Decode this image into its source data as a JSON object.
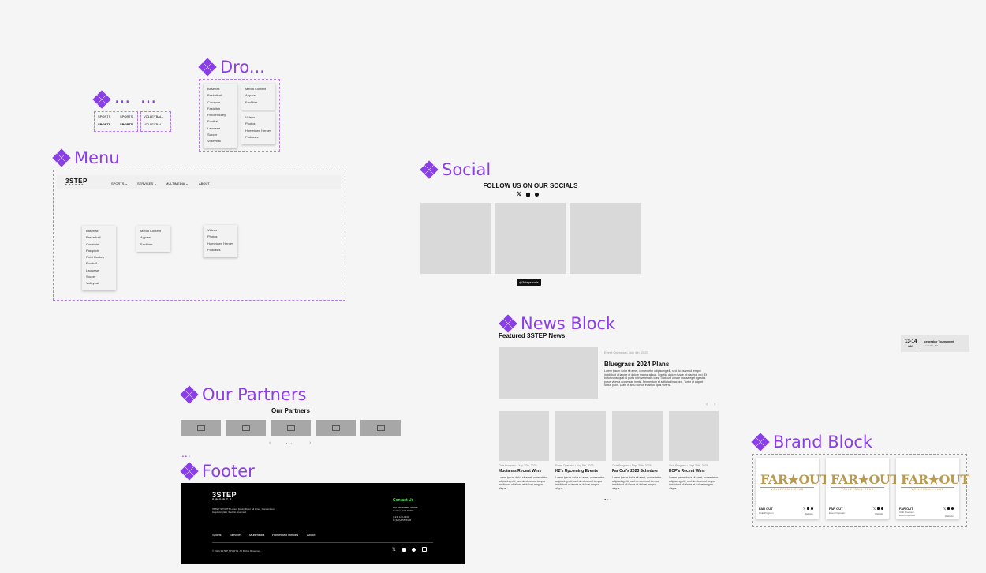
{
  "titles": {
    "dropdown": "Dro...",
    "small_a": "...",
    "small_b": "...",
    "menu": "Menu",
    "social": "Social",
    "news": "News Block",
    "partners": "Our Partners",
    "footer_dots": "...",
    "footer": "Footer",
    "brand": "Brand Block"
  },
  "variants": {
    "row1_a": "SPORTS",
    "row1_b": "SPORTS",
    "row2_a": "SPORTS",
    "row2_b": "SPORTS",
    "v1": "VOLLEYBALL",
    "v2": "VOLLEYBALL"
  },
  "dropdown": {
    "sports": [
      "Baseball",
      "Basketball",
      "Cornhole",
      "Fastpitch",
      "Field Hockey",
      "Football",
      "Lacrosse",
      "Soccer",
      "Volleyball"
    ],
    "services": [
      "Media Content",
      "Apparel",
      "Facilities"
    ],
    "multimedia": [
      "Videos",
      "Photos",
      "Hometown Heroes",
      "Podcasts"
    ]
  },
  "menu": {
    "logo": "3STEP",
    "logo_sub": "SPORTS",
    "nav": [
      "SPORTS",
      "SERVICES",
      "MULTIMEDIA",
      "ABOUT"
    ]
  },
  "social": {
    "heading": "FOLLOW US ON OUR SOCIALS",
    "handle": "@3stepsports",
    "icons": [
      "x-icon",
      "instagram-icon",
      "facebook-icon"
    ]
  },
  "news": {
    "heading": "Featured 3STEP News",
    "featured": {
      "meta": "Event Operator • July 4th, 2023",
      "title": "Bluegrass 2024 Plans",
      "body": "Lorem ipsum dolor sit amet, consectetur adipiscing elit, sed do eiusmod tempor incididunt ut labore et dolore magna aliqua. Gravida dictum fusce ut placerat orci. Et tortor consequat id porta nibh venenatis cras. Tincidunt ornare massa eget egestas purus viverra accumsan in nisl. Fermentum et sollicitudin ac orci. Tortor at aliquet luctus proin. Diam in arcu cursus euismod quis viverra."
    },
    "cards": [
      {
        "meta": "Club Program • July 27th, 2023",
        "title": "Mucianas Recent Wins",
        "body": "Lorem ipsum dolor sit amet, consectetur adipiscing elit, sed do eiusmod tempor incididunt ut labore et dolore magna aliqua."
      },
      {
        "meta": "Event Operator • Aug 8th, 2023",
        "title": "K2's Upcoming Events",
        "body": "Lorem ipsum dolor sit amet, consectetur adipiscing elit, sed do eiusmod tempor incididunt ut labore et dolore magna aliqua."
      },
      {
        "meta": "Club Program • Sept 30th, 2023",
        "title": "Far Out's 2023 Schedule",
        "body": "Lorem ipsum dolor sit amet, consectetur adipiscing elit, sed do eiusmod tempor incididunt ut labore et dolore magna aliqua."
      },
      {
        "meta": "Club Program • Sept 30th, 2023",
        "title": "ECP's Recent Wins",
        "body": "Lorem ipsum dolor sit amet, consectetur adipiscing elit, sed do eiusmod tempor incididunt ut labore et dolore magna aliqua."
      }
    ]
  },
  "event": {
    "date": "13-14",
    "month": "JAN",
    "name": "Icebreaker Tournament",
    "location": "Louisville, KY"
  },
  "partners": {
    "heading": "Our Partners"
  },
  "footer": {
    "logo": "3STEP",
    "logo_sub": "SPORTS",
    "tagline": "3STEP SPORTS Lorem Ipsum Dolor Sit Amet, Consectetur Adipiscing Elit, Sed Do Eiusmod.",
    "contact_heading": "Contact Us",
    "address1": "200 Stonewater Square",
    "address2": "Hartford, WA 07893",
    "phone": "(123) 123-4339",
    "phone2": "1 (423)-555-5365",
    "links": [
      "Sports",
      "Services",
      "Multimedia",
      "Hometown Heroes",
      "About"
    ],
    "copyright": "© 2023 3STEP SPORTS. All Rights Reserved."
  },
  "brand": {
    "logo_text": "FAR★OUT",
    "logo_sub": "VOLLEYBALL CLUB",
    "cards": [
      {
        "name": "FAR OUT",
        "sub": "Club Program",
        "role": "Website"
      },
      {
        "name": "FAR OUT",
        "sub": "Event Operator",
        "role": "Website"
      },
      {
        "name": "FAR OUT",
        "sub": "Club Program\nEvent Operator",
        "role": "Website"
      }
    ]
  },
  "colors": {
    "accent": "#8a3ee8",
    "menu_line": "#e8785c",
    "footer_bg": "#000000",
    "contact_green": "#5ee36b"
  }
}
